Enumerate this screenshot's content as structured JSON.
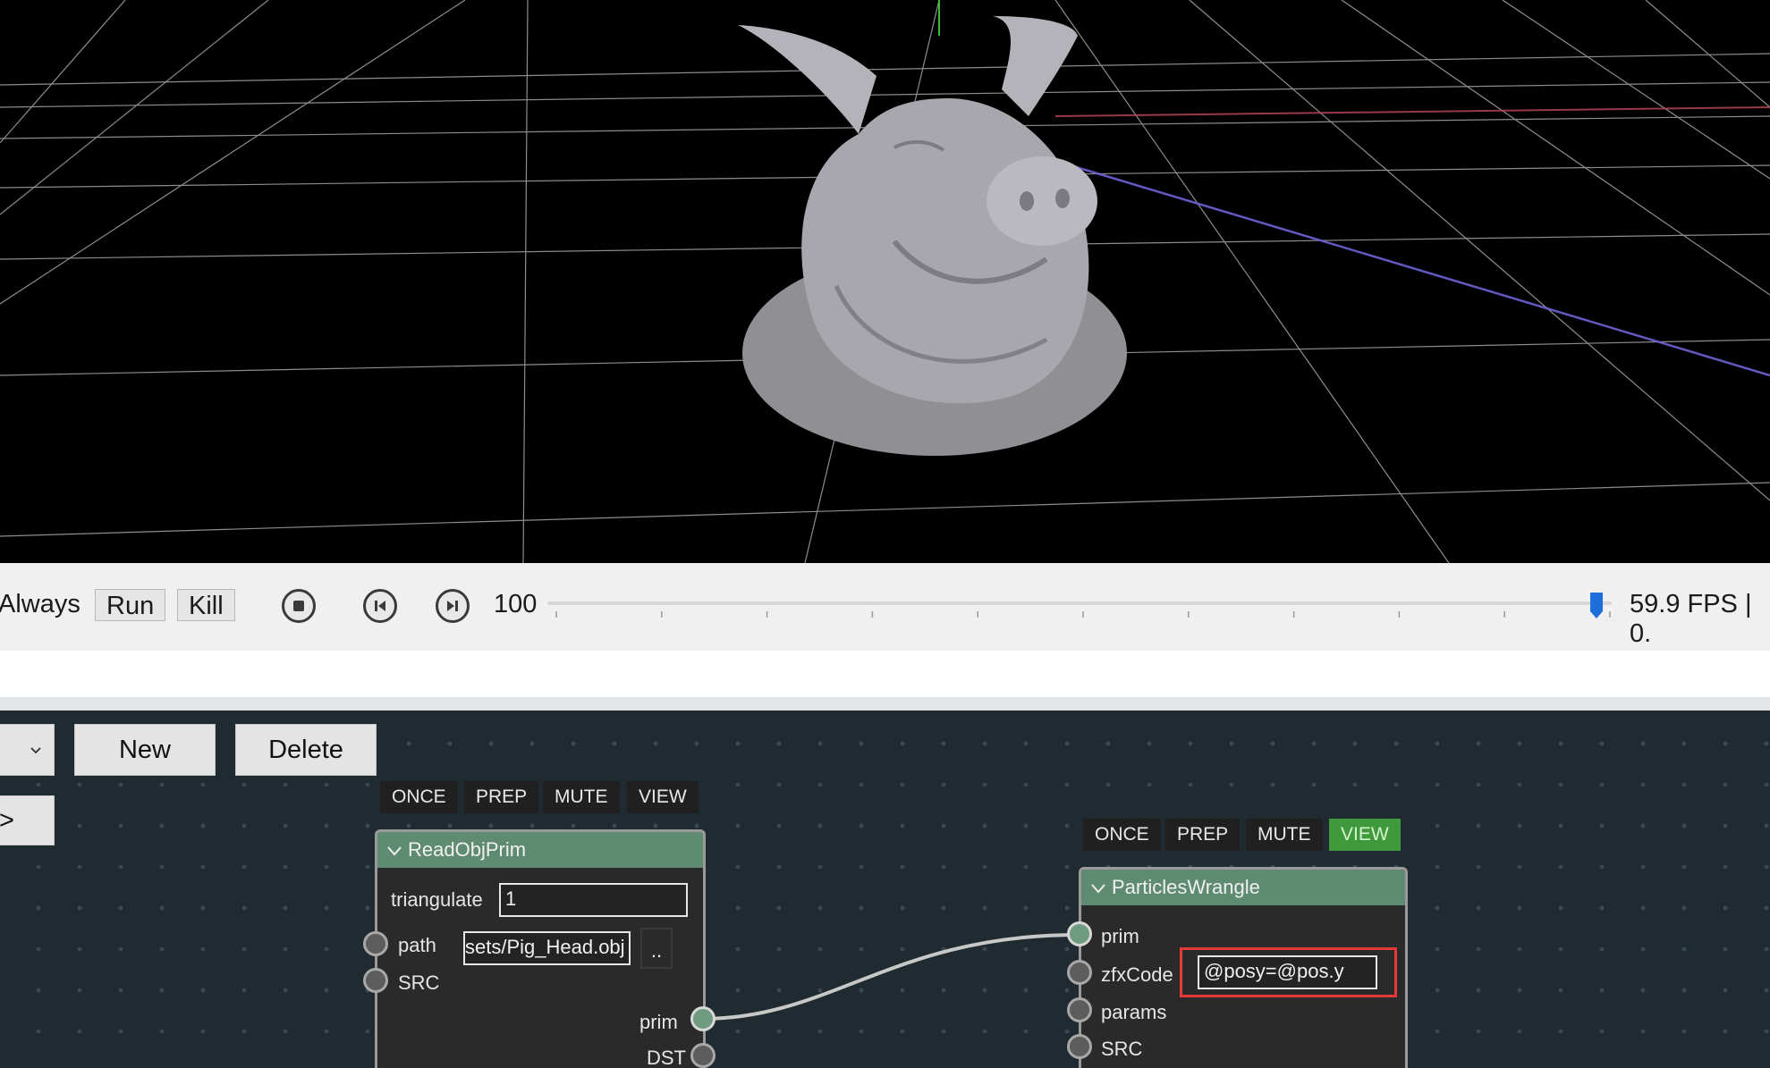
{
  "timeline": {
    "mode_label": "Always",
    "run_label": "Run",
    "kill_label": "Kill",
    "frame_value": "100",
    "fps_text": "59.9 FPS | 0.",
    "slider_position": 0.986
  },
  "editor": {
    "new_label": "New",
    "delete_label": "Delete",
    "side_button_label": ">"
  },
  "nodes": {
    "read": {
      "title": "ReadObjPrim",
      "flags": {
        "once": "ONCE",
        "prep": "PREP",
        "mute": "MUTE",
        "view": "VIEW"
      },
      "triangulate_label": "triangulate",
      "triangulate_value": "1",
      "path_label": "path",
      "path_value": "sets/Pig_Head.obj",
      "browse_label": "..",
      "src_label": "SRC",
      "prim_label": "prim",
      "dst_label": "DST"
    },
    "wrangle": {
      "title": "ParticlesWrangle",
      "flags": {
        "once": "ONCE",
        "prep": "PREP",
        "mute": "MUTE",
        "view": "VIEW"
      },
      "prim_label": "prim",
      "zfx_label": "zfxCode",
      "zfx_value": "@posy=@pos.y",
      "params_label": "params",
      "src_label": "SRC"
    }
  },
  "icons": {
    "collapse": "chevron-down-icon",
    "stop": "stop-icon",
    "prev": "step-back-icon",
    "next": "step-forward-icon",
    "dropdown": "chevron-down-icon"
  },
  "colors": {
    "node_header": "#5f8b73",
    "view_active": "#3e9a3b",
    "highlight": "#e53935",
    "slider_handle": "#1e6fd9"
  }
}
